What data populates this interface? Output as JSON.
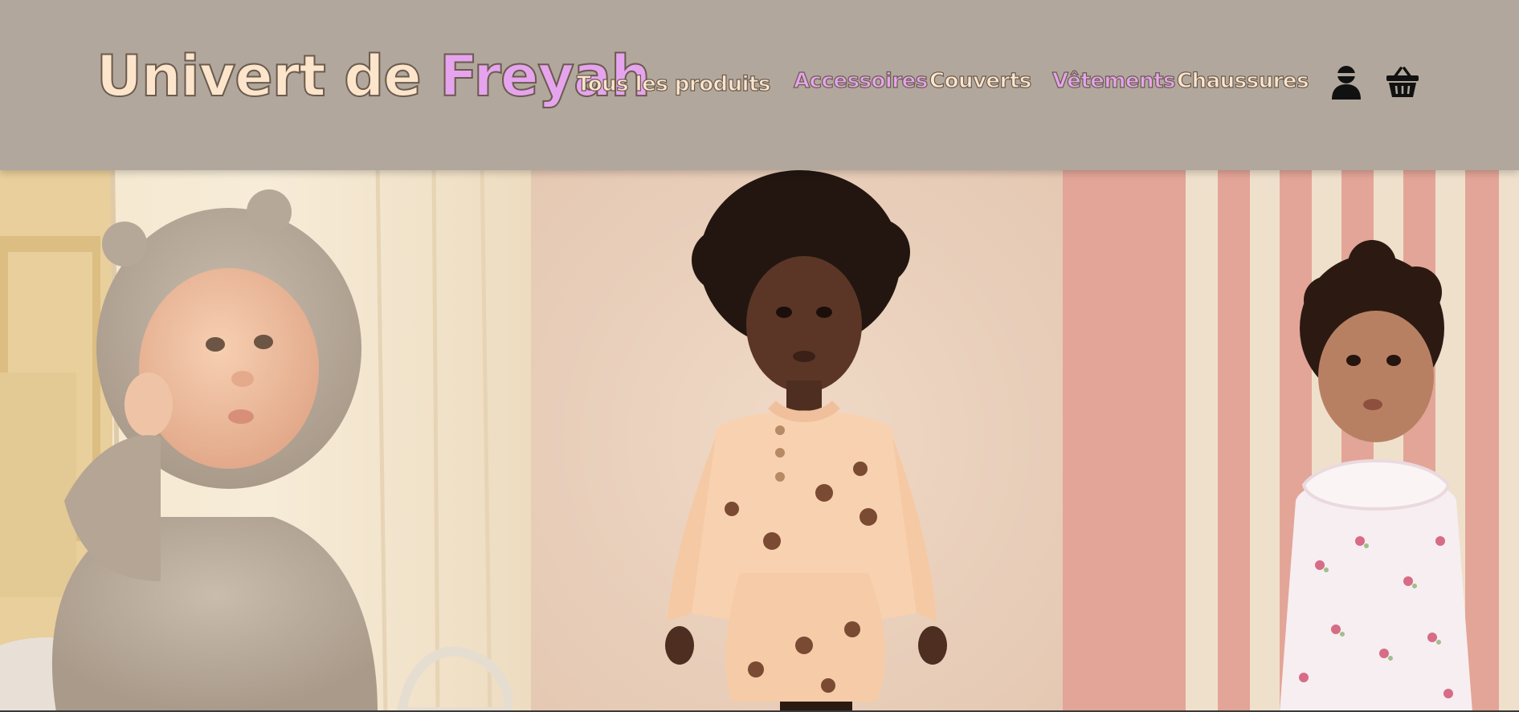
{
  "logo": {
    "part1": "Univert de ",
    "part2": "Freyah"
  },
  "nav": {
    "items": [
      {
        "label": "Tous les produits"
      },
      {
        "label": "Accessoires"
      },
      {
        "label": "Couverts"
      },
      {
        "label": "Vêtements"
      },
      {
        "label": "Chaussures"
      }
    ]
  },
  "icons": {
    "account": "user-icon",
    "cart": "basket-icon"
  },
  "hero": {
    "panels": [
      {
        "subject": "baby in teddy-bear fur suit"
      },
      {
        "subject": "toddler in apricot print set"
      },
      {
        "subject": "toddler in floral ruffle blouse"
      }
    ]
  },
  "colors": {
    "header_bg": "#b2a79c",
    "logo_cream": "#fde5cc",
    "logo_pink": "#e6a4ee",
    "stripe_pink": "#e3a597",
    "stripe_cream": "#efe0cc"
  }
}
